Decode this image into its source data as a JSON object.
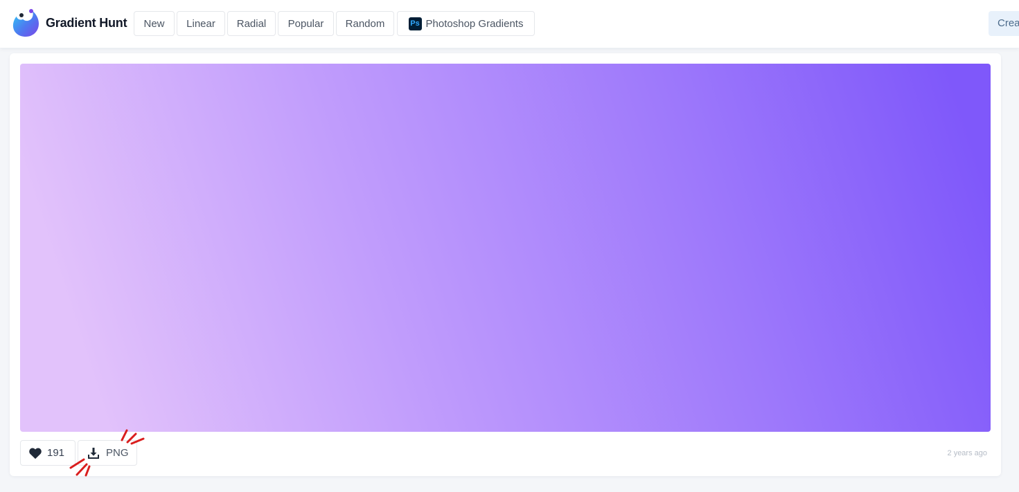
{
  "header": {
    "brand": "Gradient Hunt",
    "nav": [
      {
        "label": "New"
      },
      {
        "label": "Linear"
      },
      {
        "label": "Radial"
      },
      {
        "label": "Popular"
      },
      {
        "label": "Random"
      },
      {
        "label": "Photoshop Gradients",
        "icon": "photoshop-icon",
        "icon_text": "Ps"
      }
    ],
    "create_label": "Crea"
  },
  "gradient": {
    "colors": [
      "#e2c2fb",
      "#c09cfc",
      "#9d78fb",
      "#7f58fa"
    ]
  },
  "actions": {
    "likes": "191",
    "download_label": "PNG",
    "time_ago": "2 years ago"
  },
  "colors": {
    "annotation": "#d91e1e",
    "heart": "#1f2937"
  }
}
